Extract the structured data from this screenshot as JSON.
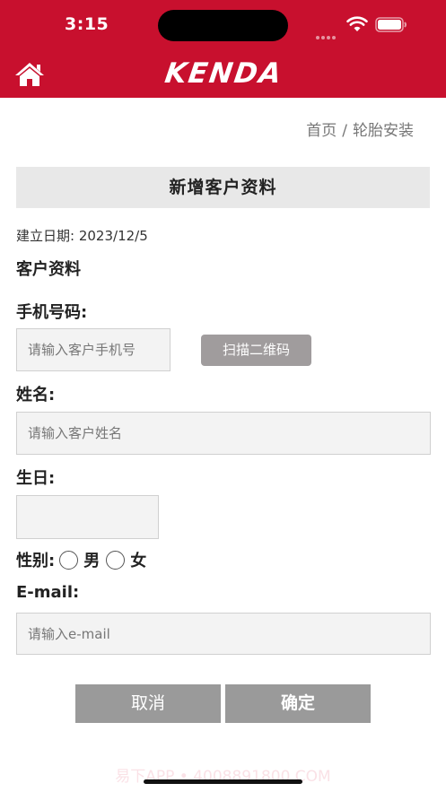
{
  "status_bar": {
    "time": "3:15"
  },
  "nav": {
    "brand": "KENDA",
    "home_icon": "home-icon",
    "background_color": "#c8102e"
  },
  "breadcrumb": {
    "home": "首页",
    "separator": "/",
    "current": "轮胎安装"
  },
  "page_title": "新增客户资料",
  "created": {
    "label": "建立日期:",
    "date": "2023/12/5"
  },
  "section_title": "客户资料",
  "form": {
    "phone": {
      "label": "手机号码:",
      "placeholder": "请输入客户手机号",
      "value": "",
      "scan_button": "扫描二维码"
    },
    "name": {
      "label": "姓名:",
      "placeholder": "请输入客户姓名",
      "value": ""
    },
    "birthday": {
      "label": "生日:",
      "value": ""
    },
    "gender": {
      "label": "性别:",
      "options": [
        "男",
        "女"
      ],
      "selected": null
    },
    "email": {
      "label": "E-mail:",
      "placeholder": "请输入e-mail",
      "value": ""
    }
  },
  "actions": {
    "cancel": "取消",
    "confirm": "确定"
  },
  "watermark": "易下APP • 4008891800.COM",
  "colors": {
    "accent": "#c8102e",
    "button_gray": "#9a9a9a",
    "scan_button": "#a09c9d",
    "input_bg": "#f3f3f3",
    "title_bar_bg": "#e8e8e8"
  }
}
